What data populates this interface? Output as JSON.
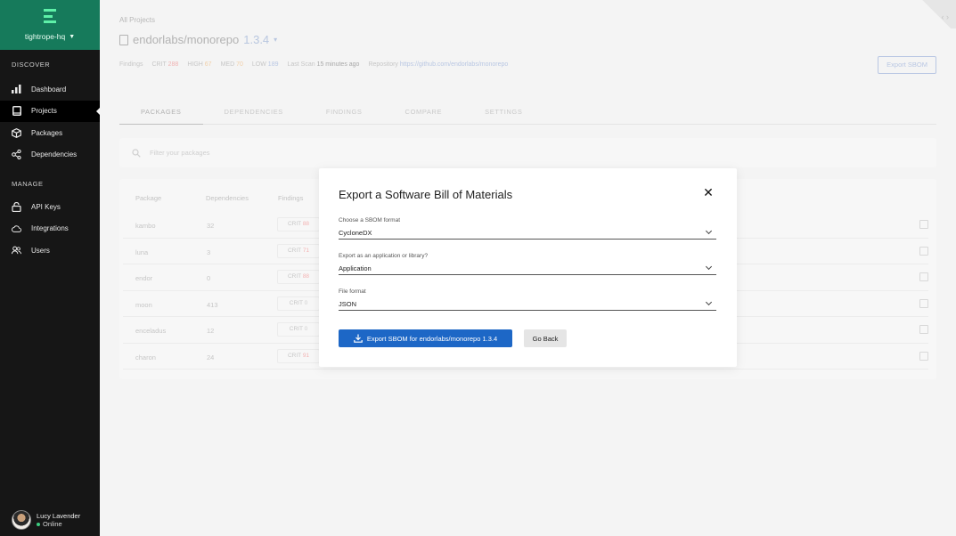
{
  "sidebar": {
    "org": "tightrope-hq",
    "sections": {
      "discover": "DISCOVER",
      "manage": "MANAGE"
    },
    "discover_items": [
      {
        "label": "Dashboard",
        "icon": "bar-chart-icon"
      },
      {
        "label": "Projects",
        "icon": "book-icon",
        "active": true
      },
      {
        "label": "Packages",
        "icon": "box-icon"
      },
      {
        "label": "Dependencies",
        "icon": "share-nodes-icon"
      }
    ],
    "manage_items": [
      {
        "label": "API Keys",
        "icon": "lock-icon"
      },
      {
        "label": "Integrations",
        "icon": "cloud-icon"
      },
      {
        "label": "Users",
        "icon": "users-icon"
      }
    ],
    "user": {
      "name": "Lucy Lavender",
      "status": "Online"
    }
  },
  "project": {
    "breadcrumb": "All Projects",
    "name": "endorlabs/monorepo",
    "version": "1.3.4",
    "meta": {
      "findings_label": "Findings",
      "crit_label": "CRIT",
      "crit": "288",
      "high_label": "HIGH",
      "high": "67",
      "med_label": "MED",
      "med": "70",
      "low_label": "LOW",
      "low": "189",
      "scan_label": "Last Scan",
      "scan_value": "15 minutes ago",
      "repo_label": "Repository",
      "repo_value": "https://github.com/endorlabs/monorepo"
    },
    "export_button": "Export SBOM"
  },
  "tabs": [
    "PACKAGES",
    "DEPENDENCIES",
    "FINDINGS",
    "COMPARE",
    "SETTINGS"
  ],
  "filter": {
    "placeholder": "Filter your packages"
  },
  "table": {
    "headers": [
      "Package",
      "Dependencies",
      "Findings"
    ],
    "rows": [
      {
        "package": "kambo",
        "deps": "32",
        "crit_label": "CRIT",
        "crit": "88"
      },
      {
        "package": "luna",
        "deps": "3",
        "crit_label": "CRIT",
        "crit": "71"
      },
      {
        "package": "endor",
        "deps": "0",
        "crit_label": "CRIT",
        "crit": "88"
      },
      {
        "package": "moon",
        "deps": "413",
        "crit_label": "CRIT",
        "crit": "0"
      },
      {
        "package": "enceladus",
        "deps": "12",
        "crit_label": "CRIT",
        "crit": "0"
      },
      {
        "package": "charon",
        "deps": "24",
        "crit_label": "CRIT",
        "crit": "91"
      }
    ]
  },
  "modal": {
    "title": "Export a Software Bill of Materials",
    "fields": [
      {
        "label": "Choose a SBOM format",
        "value": "CycloneDX"
      },
      {
        "label": "Export as an application or library?",
        "value": "Application"
      },
      {
        "label": "File format",
        "value": "JSON"
      }
    ],
    "primary_button": "Export SBOM for endorlabs/monorepo 1.3.4",
    "secondary_button": "Go Back"
  },
  "colors": {
    "brand": "#167a5b",
    "accent": "#1d67c6",
    "sidebar": "#161616"
  }
}
